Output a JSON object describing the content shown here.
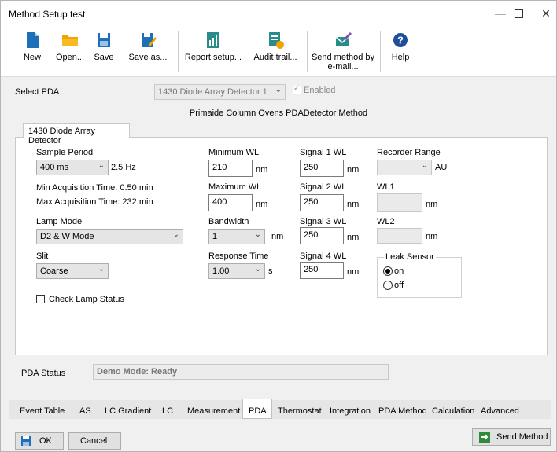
{
  "window": {
    "title": "Method Setup test"
  },
  "toolbar": {
    "new": "New",
    "open": "Open...",
    "save": "Save",
    "save_as": "Save as...",
    "report_setup": "Report setup...",
    "audit_trail": "Audit trail...",
    "send_method_line1": "Send method by",
    "send_method_line2": "e-mail...",
    "help": "Help"
  },
  "select_pda": {
    "label": "Select PDA",
    "value": "1430 Diode Array Detector 1",
    "enabled_label": "Enabled",
    "enabled_checked": true
  },
  "section_title": "Primaide Column Ovens PDADetector Method",
  "tab_label": "1430 Diode Array Detector",
  "form": {
    "sample_period_label": "Sample Period",
    "sample_period_value": "400 ms",
    "sample_period_hz": "2.5 Hz",
    "min_acq": "Min Acquisition Time: 0.50 min",
    "max_acq": "Max Acquisition Time: 232 min",
    "lamp_mode_label": "Lamp Mode",
    "lamp_mode_value": "D2 & W Mode",
    "slit_label": "Slit",
    "slit_value": "Coarse",
    "check_lamp_label": "Check Lamp Status",
    "check_lamp_checked": false,
    "min_wl_label": "Minimum WL",
    "min_wl_value": "210",
    "max_wl_label": "Maximum WL",
    "max_wl_value": "400",
    "bandwidth_label": "Bandwidth",
    "bandwidth_value": "1",
    "response_label": "Response Time",
    "response_value": "1.00",
    "response_unit": "s",
    "nm": "nm",
    "signal1_label": "Signal 1 WL",
    "signal1_value": "250",
    "signal2_label": "Signal 2 WL",
    "signal2_value": "250",
    "signal3_label": "Signal 3 WL",
    "signal3_value": "250",
    "signal4_label": "Signal 4 WL",
    "signal4_value": "250",
    "recorder_label": "Recorder Range",
    "recorder_unit": "AU",
    "wl1_label": "WL1",
    "wl2_label": "WL2",
    "leak_label": "Leak Sensor",
    "leak_on": "on",
    "leak_off": "off",
    "leak_selected": "on"
  },
  "status": {
    "label": "PDA Status",
    "value": "Demo Mode: Ready"
  },
  "bottom_tabs": [
    "Event Table",
    "AS",
    "LC Gradient",
    "LC",
    "Measurement",
    "PDA",
    "Thermostat",
    "Integration",
    "PDA Method",
    "Calculation",
    "Advanced"
  ],
  "active_bottom_tab": "PDA",
  "footer": {
    "ok": "OK",
    "cancel": "Cancel",
    "send_method": "Send Method"
  },
  "colors": {
    "accent_blue": "#1e6fb8",
    "folder_yellow": "#f0a400",
    "teal": "#2a8b8b",
    "green": "#2e8b3a"
  }
}
